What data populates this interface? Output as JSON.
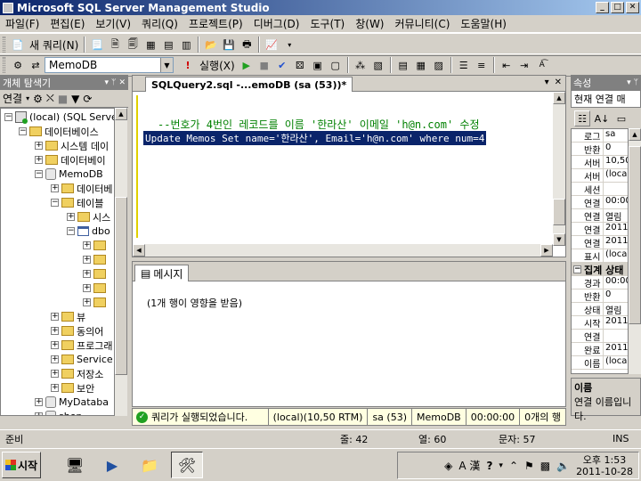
{
  "window": {
    "title": "Microsoft SQL Server Management Studio"
  },
  "menu": [
    "파일(F)",
    "편집(E)",
    "보기(V)",
    "쿼리(Q)",
    "프로젝트(P)",
    "디버그(D)",
    "도구(T)",
    "창(W)",
    "커뮤니티(C)",
    "도움말(H)"
  ],
  "toolbar1": {
    "new_query": "새 쿼리(N)"
  },
  "toolbar2": {
    "database": "MemoDB",
    "execute": "실행(X)"
  },
  "explorer": {
    "title": "개체 탐색기",
    "connect": "연결",
    "nodes": [
      {
        "label": "(local) (SQL Server"
      },
      {
        "label": "데이터베이스"
      },
      {
        "label": "시스템 데이"
      },
      {
        "label": "데이터베이"
      },
      {
        "label": "MemoDB"
      },
      {
        "label": "데이터베"
      },
      {
        "label": "테이블"
      },
      {
        "label": "시스"
      },
      {
        "label": "dbo"
      },
      {
        "label": ""
      },
      {
        "label": ""
      },
      {
        "label": ""
      },
      {
        "label": ""
      },
      {
        "label": ""
      },
      {
        "label": "뷰"
      },
      {
        "label": "동의어"
      },
      {
        "label": "프로그래"
      },
      {
        "label": "Service"
      },
      {
        "label": "저장소"
      },
      {
        "label": "보안"
      },
      {
        "label": "MyDataba"
      },
      {
        "label": "shop"
      },
      {
        "label": "보안"
      }
    ]
  },
  "editor": {
    "tab": "SQLQuery2.sql -...emoDB (sa (53))*",
    "comment": "--번호가 4번인 레코드를 이름 '한라산' 이메일 'h@n.com' 수정",
    "sql": "Update Memos Set name='한라산', Email='h@n.com' where num=4"
  },
  "messages": {
    "tab": "메시지",
    "text": "(1개 행이 영향을 받음)"
  },
  "query_status": {
    "message": "쿼리가 실행되었습니다.",
    "server": "(local)(10,50 RTM)",
    "user": "sa (53)",
    "db": "MemoDB",
    "time": "00:00:00",
    "rows": "0개의 행"
  },
  "properties": {
    "title": "속성",
    "selected": "현재 연결 매",
    "rows": [
      {
        "k": "로그",
        "v": "sa"
      },
      {
        "k": "반환",
        "v": "0"
      },
      {
        "k": "서버",
        "v": "10,50,"
      },
      {
        "k": "서버",
        "v": "(loca"
      },
      {
        "k": "세션",
        "v": ""
      },
      {
        "k": "연결",
        "v": "00:00"
      },
      {
        "k": "연결",
        "v": "열림"
      },
      {
        "k": "연결",
        "v": "2011-"
      },
      {
        "k": "연결",
        "v": "2011-"
      },
      {
        "k": "표시",
        "v": "(loca"
      }
    ],
    "category": "집계 상태",
    "rows2": [
      {
        "k": "경과",
        "v": "00:00"
      },
      {
        "k": "반환",
        "v": "0"
      },
      {
        "k": "상태",
        "v": "열림"
      },
      {
        "k": "시작",
        "v": "2011-"
      },
      {
        "k": "연결",
        "v": ""
      },
      {
        "k": "완료",
        "v": "2011-"
      },
      {
        "k": "이름",
        "v": "(loca"
      }
    ],
    "desc_title": "이름",
    "desc_text": "연결 이름입니다."
  },
  "statusbar": {
    "ready": "준비",
    "line": "줄: 42",
    "col": "열: 60",
    "char": "문자: 57",
    "mode": "INS"
  },
  "taskbar": {
    "start": "시작",
    "ime": "A 漢",
    "time": "오후 1:53",
    "date": "2011-10-28"
  }
}
